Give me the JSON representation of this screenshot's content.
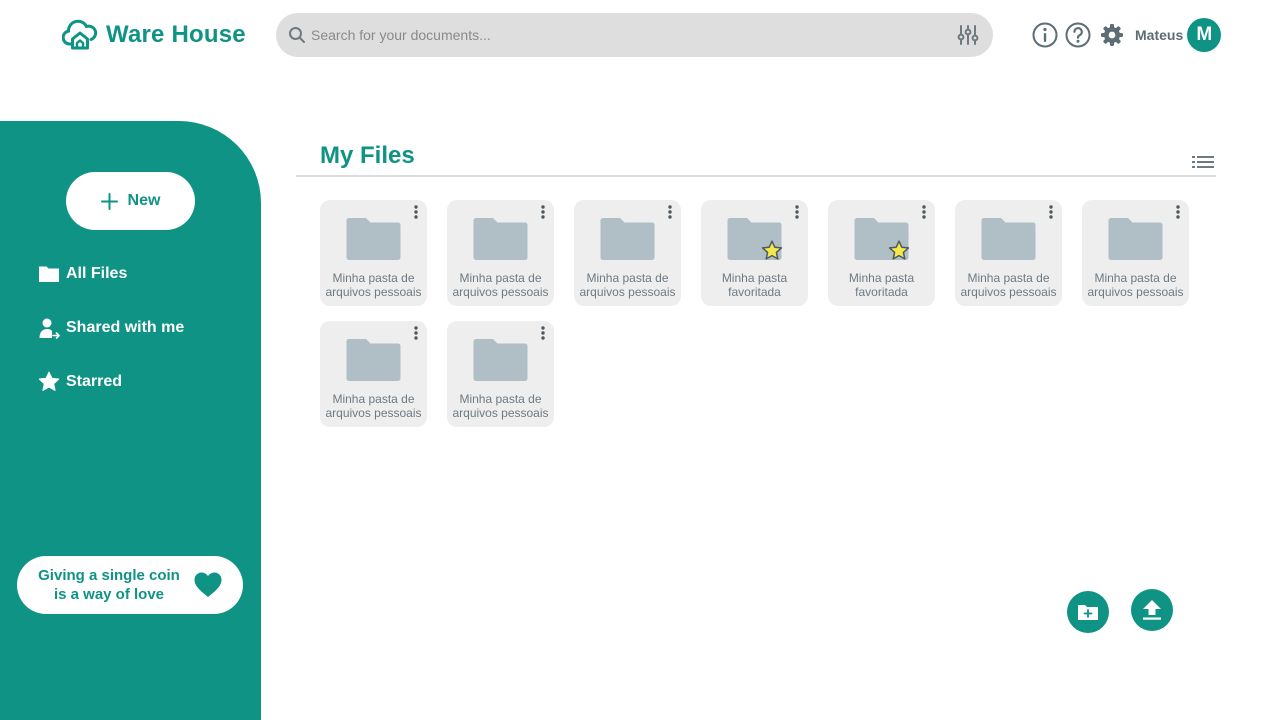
{
  "header": {
    "app_name": "Ware House",
    "search_placeholder": "Search for your documents...",
    "user_name": "Mateus",
    "avatar_initial": "M"
  },
  "sidebar": {
    "new_label": "New",
    "items": [
      {
        "label": "All Files",
        "icon": "folder-icon"
      },
      {
        "label": "Shared with me",
        "icon": "shared-user-icon"
      },
      {
        "label": "Starred",
        "icon": "star-icon"
      }
    ],
    "donate_text": "Giving a single coin is a way of love"
  },
  "main": {
    "title": "My Files",
    "folders": [
      {
        "label": "Minha pasta de arquivos pessoais",
        "starred": false
      },
      {
        "label": "Minha pasta de arquivos pessoais",
        "starred": false
      },
      {
        "label": "Minha pasta de arquivos pessoais",
        "starred": false
      },
      {
        "label": "Minha pasta favoritada",
        "starred": true
      },
      {
        "label": "Minha pasta favoritada",
        "starred": true
      },
      {
        "label": "Minha pasta de arquivos pessoais",
        "starred": false
      },
      {
        "label": "Minha pasta de arquivos pessoais",
        "starred": false
      },
      {
        "label": "Minha pasta de arquivos pessoais",
        "starred": false
      },
      {
        "label": "Minha pasta de arquivos pessoais",
        "starred": false
      }
    ]
  },
  "colors": {
    "accent": "#0f9384",
    "folder": "#b0bec5",
    "card_bg": "#eeeeee",
    "star": "#f5e84a"
  }
}
